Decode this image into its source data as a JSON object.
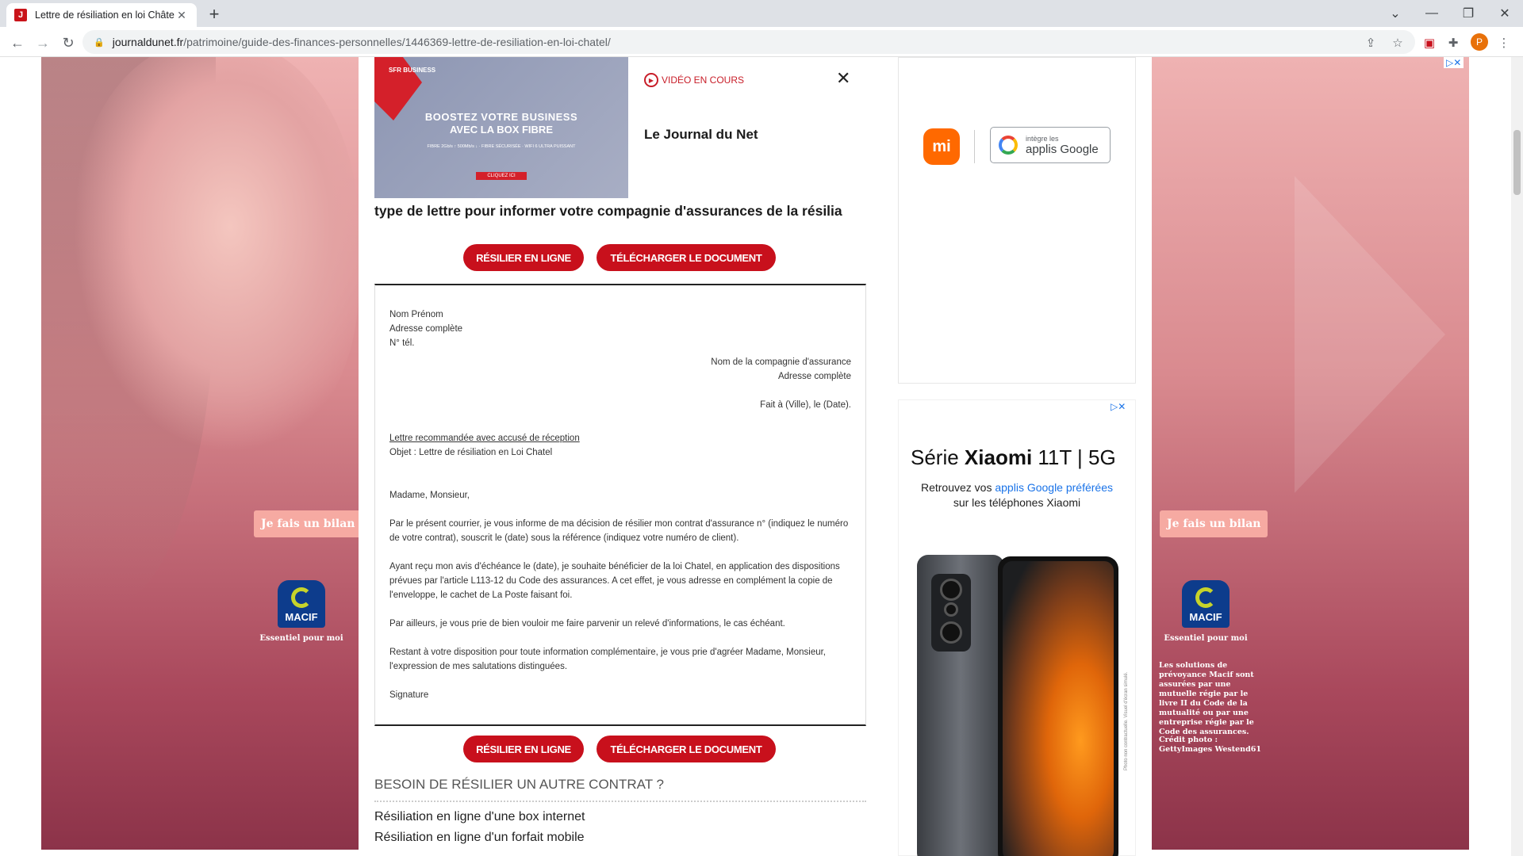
{
  "browser": {
    "tab_title": "Lettre de résiliation en loi Châtel",
    "tab_favicon": "JDN",
    "url_host": "journaldunet.fr",
    "url_path": "/patrimoine/guide-des-finances-personnelles/1446369-lettre-de-resiliation-en-loi-chatel/",
    "profile_initial": "P"
  },
  "skin": {
    "bilan_label": "Je fais un bilan",
    "macif_label": "MACIF",
    "tagline": "Essentiel pour moi",
    "legal_text": "Les solutions de prévoyance Macif sont assurées par une mutuelle régie par le livre II du Code de la mutualité ou par une entreprise régie par le Code des assurances.",
    "credit_text": "Crédit photo : GettyImages Westend61"
  },
  "video": {
    "brand_tag": "SFR BUSINESS",
    "line1": "BOOSTEZ VOTRE BUSINESS",
    "line2": "AVEC LA BOX FIBRE",
    "line3": "FIBRE 2Gb/s ↑ 500Mb/s ↓ · FIBRE SÉCURISÉE · WIFI 6 ULTRA PUISSANT",
    "cta": "CLIQUEZ ICI",
    "status": "VIDÉO EN COURS",
    "publisher": "Le Journal du Net"
  },
  "article": {
    "intro_line": "type de lettre pour informer votre compagnie d'assurances de la résilia",
    "btn_resilier": "RÉSILIER EN LIGNE",
    "btn_telecharger": "TÉLÉCHARGER LE DOCUMENT",
    "letter": {
      "sender_name": "Nom Prénom",
      "sender_address": "Adresse complète",
      "sender_phone": "N° tél.",
      "recipient_name": "Nom de la compagnie d'assurance",
      "recipient_address": "Adresse complète",
      "place_date": "Fait à (Ville), le (Date).",
      "registered": "Lettre recommandée avec accusé de réception",
      "object": "Objet : Lettre de résiliation en Loi Chatel",
      "salutation": "Madame, Monsieur,",
      "p1": "Par le présent courrier, je vous informe de ma décision de résilier mon contrat d'assurance n° (indiquez le numéro de votre contrat), souscrit le (date) sous la référence (indiquez votre numéro de client).",
      "p2": "Ayant reçu mon avis d'échéance le (date), je souhaite bénéficier de la loi Chatel, en application des dispositions prévues par l'article L113-12 du Code des assurances. A cet effet, je vous adresse en complément la copie de l'enveloppe, le cachet de La Poste faisant foi.",
      "p3": "Par ailleurs, je vous prie de bien vouloir me faire parvenir un relevé d'informations, le cas échéant.",
      "p4": "Restant à votre disposition pour toute information complémentaire, je vous prie d'agréer Madame, Monsieur, l'expression de mes salutations distinguées.",
      "signature": "Signature"
    },
    "need_heading": "BESOIN DE RÉSILIER UN AUTRE CONTRAT ?",
    "links": [
      "Résiliation en ligne d'une box internet",
      "Résiliation en ligne d'un forfait mobile"
    ]
  },
  "ads": {
    "mi_logo": "mi",
    "google_small": "intègre les",
    "google_big": "applis Google",
    "xiaomi_title_pre": "Série ",
    "xiaomi_title_bold": "Xiaomi",
    "xiaomi_title_post": " 11T | 5G",
    "retrouvez_pre": "Retrouvez vos ",
    "retrouvez_link": "applis Google préférées",
    "retrouvez_post": "sur les téléphones Xiaomi",
    "fine_print": "Photo non contractuelle. Visuel d'écran simulé.",
    "adchoice": "▷✕"
  },
  "colors": {
    "brand_red": "#c8101c",
    "macif_blue": "#0d3c8c",
    "xiaomi_orange": "#ff6900"
  }
}
